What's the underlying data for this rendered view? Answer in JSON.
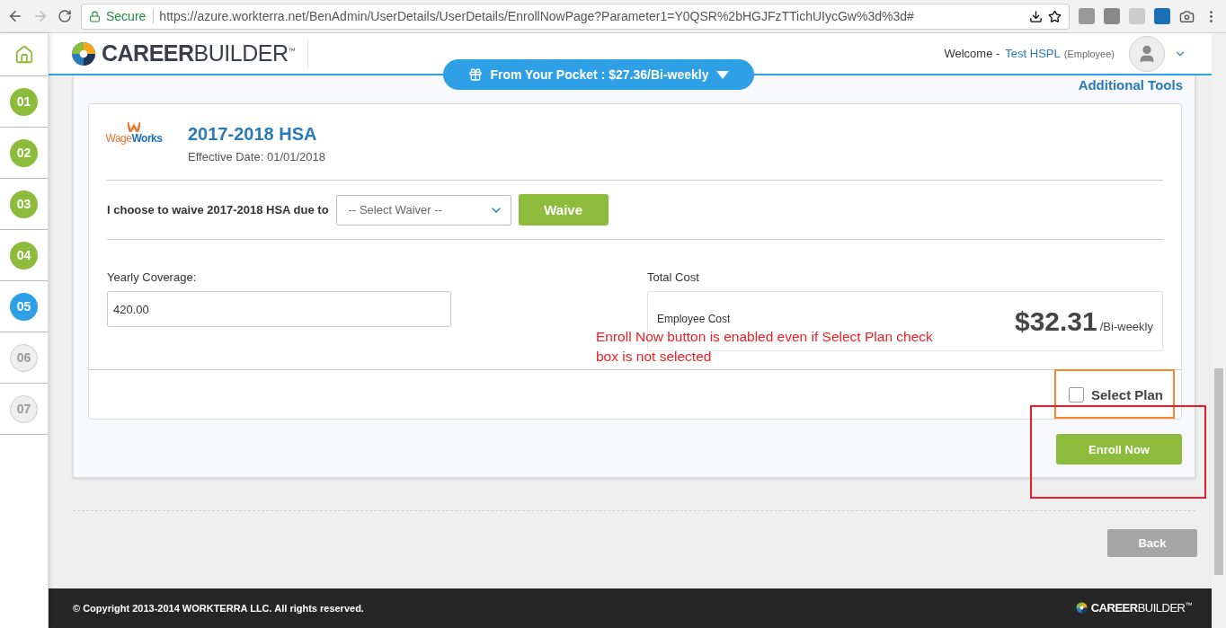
{
  "browser": {
    "secure_label": "Secure",
    "url": "https://azure.workterra.net/BenAdmin/UserDetails/UserDetails/EnrollNowPage?Parameter1=Y0QSR%2bHGJFzTTichUIycGw%3d%3d#"
  },
  "steps": [
    {
      "label": "01",
      "kind": "done"
    },
    {
      "label": "02",
      "kind": "done"
    },
    {
      "label": "03",
      "kind": "done"
    },
    {
      "label": "04",
      "kind": "done"
    },
    {
      "label": "05",
      "kind": "current"
    },
    {
      "label": "06",
      "kind": "pending"
    },
    {
      "label": "07",
      "kind": "pending"
    }
  ],
  "header": {
    "logo": "**CAREER**BUILDER$^{™}$",
    "welcome": "Welcome -",
    "user_name": "Test HSPL",
    "user_role": "(Employee)"
  },
  "pocket": {
    "label": "From Your Pocket : $27.36/Bi-weekly"
  },
  "additional_tools": "Additional Tools",
  "plan": {
    "provider_logo": "Wage**Works**",
    "title": "2017-2018 HSA",
    "effective_date": "Effective Date: 01/01/2018",
    "waive_label": "I choose to waive 2017-2018 HSA due to",
    "waiver_placeholder": "-- Select Waiver --",
    "waive_button": "Waive",
    "coverage_label": "Yearly Coverage:",
    "coverage_value": "420.00",
    "total_cost_label": "Total Cost",
    "employee_cost_label": "Employee Cost",
    "employee_cost": "$32.31",
    "period": "/Bi-weekly",
    "select_plan": {
      "label": "Select Plan",
      "checked": false
    }
  },
  "enroll_button": "Enroll Now",
  "back_button": "Back",
  "annotation": {
    "text": "Enroll Now button is enabled even if Select Plan check box is not selected"
  },
  "footer": {
    "copyright": "© Copyright 2013-2014 WORKTERRA LLC. All rights reserved.",
    "logo": "**CAREER**BUILDER$^{™}$"
  }
}
